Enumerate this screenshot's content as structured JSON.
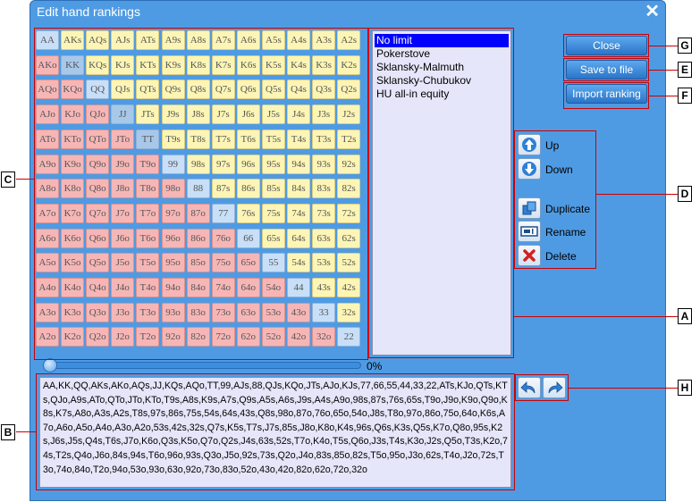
{
  "window": {
    "title": "Edit hand rankings",
    "close_glyph": "✕"
  },
  "hand_grid": [
    [
      "AA",
      "AKs",
      "AQs",
      "AJs",
      "ATs",
      "A9s",
      "A8s",
      "A7s",
      "A6s",
      "A5s",
      "A4s",
      "A3s",
      "A2s"
    ],
    [
      "AKo",
      "KK",
      "KQs",
      "KJs",
      "KTs",
      "K9s",
      "K8s",
      "K7s",
      "K6s",
      "K5s",
      "K4s",
      "K3s",
      "K2s"
    ],
    [
      "AQo",
      "KQo",
      "QQ",
      "QJs",
      "QTs",
      "Q9s",
      "Q8s",
      "Q7s",
      "Q6s",
      "Q5s",
      "Q4s",
      "Q3s",
      "Q2s"
    ],
    [
      "AJo",
      "KJo",
      "QJo",
      "JJ",
      "JTs",
      "J9s",
      "J8s",
      "J7s",
      "J6s",
      "J5s",
      "J4s",
      "J3s",
      "J2s"
    ],
    [
      "ATo",
      "KTo",
      "QTo",
      "JTo",
      "TT",
      "T9s",
      "T8s",
      "T7s",
      "T6s",
      "T5s",
      "T4s",
      "T3s",
      "T2s"
    ],
    [
      "A9o",
      "K9o",
      "Q9o",
      "J9o",
      "T9o",
      "99",
      "98s",
      "97s",
      "96s",
      "95s",
      "94s",
      "93s",
      "92s"
    ],
    [
      "A8o",
      "K8o",
      "Q8o",
      "J8o",
      "T8o",
      "98o",
      "88",
      "87s",
      "86s",
      "85s",
      "84s",
      "83s",
      "82s"
    ],
    [
      "A7o",
      "K7o",
      "Q7o",
      "J7o",
      "T7o",
      "97o",
      "87o",
      "77",
      "76s",
      "75s",
      "74s",
      "73s",
      "72s"
    ],
    [
      "A6o",
      "K6o",
      "Q6o",
      "J6o",
      "T6o",
      "96o",
      "86o",
      "76o",
      "66",
      "65s",
      "64s",
      "63s",
      "62s"
    ],
    [
      "A5o",
      "K5o",
      "Q5o",
      "J5o",
      "T5o",
      "95o",
      "85o",
      "75o",
      "65o",
      "55",
      "54s",
      "53s",
      "52s"
    ],
    [
      "A4o",
      "K4o",
      "Q4o",
      "J4o",
      "T4o",
      "94o",
      "84o",
      "74o",
      "64o",
      "54o",
      "44",
      "43s",
      "42s"
    ],
    [
      "A3o",
      "K3o",
      "Q3o",
      "J3o",
      "T3o",
      "93o",
      "83o",
      "73o",
      "63o",
      "53o",
      "43o",
      "33",
      "32s"
    ],
    [
      "A2o",
      "K2o",
      "Q2o",
      "J2o",
      "T2o",
      "92o",
      "82o",
      "72o",
      "62o",
      "52o",
      "42o",
      "32o",
      "22"
    ]
  ],
  "rankings_list": {
    "items": [
      "No limit",
      "Pokerstove",
      "Sklansky-Malmuth",
      "Sklansky-Chubukov",
      "HU all-in equity"
    ],
    "selected": "No limit"
  },
  "buttons": {
    "close": "Close",
    "save": "Save to file",
    "import": "Import ranking"
  },
  "operations": {
    "up": "Up",
    "down": "Down",
    "duplicate": "Duplicate",
    "rename": "Rename",
    "delete": "Delete"
  },
  "slider": {
    "percent_label": "0%",
    "value_percent": 0
  },
  "ranking_text": "AA,KK,QQ,AKs,AKo,AQs,JJ,KQs,AQo,TT,99,AJs,88,QJs,KQo,JTs,AJo,KJs,77,66,55,44,33,22,ATs,KJo,QTs,KTs,QJo,A9s,ATo,QTo,JTo,KTo,T9s,A8s,K9s,A7s,Q9s,A5s,A6s,J9s,A4s,A9o,98s,87s,76s,65s,T9o,J9o,K9o,Q9o,K8s,K7s,A8o,A3s,A2s,T8s,97s,86s,75s,54s,64s,43s,Q8s,98o,87o,76o,65o,54o,J8s,T8o,97o,86o,75o,64o,K6s,A7o,A6o,A5o,A4o,A3o,A2o,53s,42s,32s,Q7s,K5s,T7s,J7s,85s,J8o,K8o,K4s,96s,Q6s,K3s,Q5s,K7o,Q8o,95s,K2s,J6s,J5s,Q4s,T6s,J7o,K6o,Q3s,K5o,Q7o,Q2s,J4s,63s,52s,T7o,K4o,T5s,Q6o,J3s,T4s,K3o,J2s,Q5o,T3s,K2o,74s,T2s,Q4o,J6o,84s,94s,T6o,96o,93s,Q3o,J5o,92s,73s,Q2o,J4o,83s,85o,82s,T5o,95o,J3o,62s,T4o,J2o,72s,T3o,74o,84o,T2o,94o,53o,93o,63o,92o,73o,83o,52o,43o,42o,82o,62o,72o,32o",
  "history": {
    "undo_icon": "undo-icon",
    "redo_icon": "redo-icon"
  },
  "callouts": {
    "a": "A",
    "b": "B",
    "c": "C",
    "d": "D",
    "e": "E",
    "f": "F",
    "g": "G",
    "h": "H"
  },
  "colors": {
    "suited": "#fdf5b5",
    "offsuit": "#f7b6b6",
    "pair": "#c8dff7",
    "title_bar": "#4f9be3",
    "list_bg": "#e6e6fa",
    "callout": "#cc0000"
  }
}
